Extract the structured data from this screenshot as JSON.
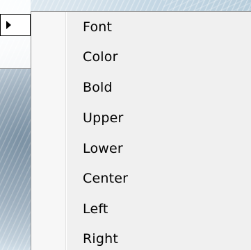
{
  "menu": {
    "items": [
      {
        "label": "Font"
      },
      {
        "label": "Color"
      },
      {
        "label": "Bold"
      },
      {
        "label": "Upper"
      },
      {
        "label": "Lower"
      },
      {
        "label": "Center"
      },
      {
        "label": "Left"
      },
      {
        "label": "Right"
      }
    ]
  },
  "icons": {
    "submenu_arrow": "triangle-right-icon"
  },
  "colors": {
    "menu_background": "#f0f0f0",
    "menu_border": "#979797",
    "menu_text": "#000000"
  }
}
